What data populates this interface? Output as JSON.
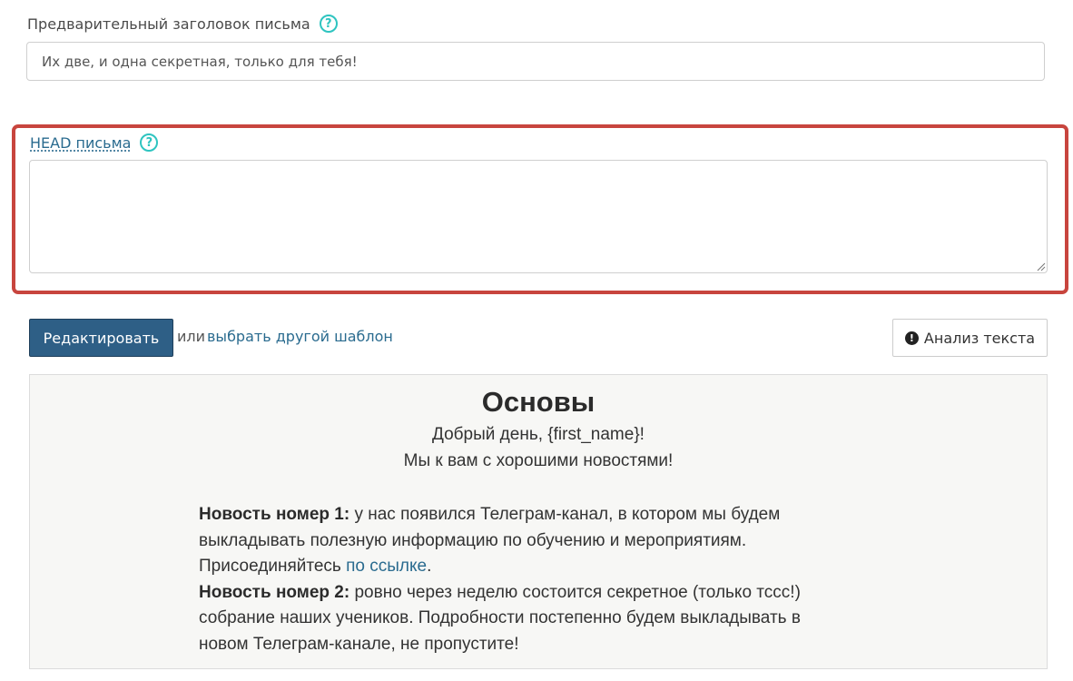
{
  "preheader": {
    "label": "Предварительный заголовок письма",
    "value": "Их две, и одна секретная, только для тебя!"
  },
  "head": {
    "label": "HEAD письма",
    "value": ""
  },
  "help_icon_glyph": "?",
  "actions": {
    "edit_label": "Редактировать",
    "or_text": "или",
    "choose_template_label": "выбрать другой шаблон",
    "analyze_label": "Анализ текста",
    "analyze_icon_glyph": "!"
  },
  "preview": {
    "title": "Основы",
    "greeting": "Добрый день, {first_name}!",
    "intro": "Мы к вам с хорошими новостями!",
    "news1": {
      "label": "Новость номер 1:",
      "text": "  у нас появился Телеграм-канал, в котором мы будем выкладывать полезную информацию по обучению и мероприятиям. Присоединяйтесь ",
      "link": "по ссылке",
      "after_link": "."
    },
    "news2": {
      "label": "Новость номер 2:",
      "text": " ровно через неделю состоится секретное (только тссс!) собрание наших учеников. Подробности постепенно будем выкладывать в новом Телеграм-канале, не пропустите!"
    }
  },
  "colors": {
    "help_icon": "#2ec4c0",
    "highlight_border": "#c8453e",
    "primary_button": "#2e5f86",
    "link": "#2a6b8f",
    "preview_bg": "#f7f7f5"
  },
  "icons": [
    "question-circle-icon",
    "exclamation-circle-icon",
    "resize-grip-icon"
  ]
}
